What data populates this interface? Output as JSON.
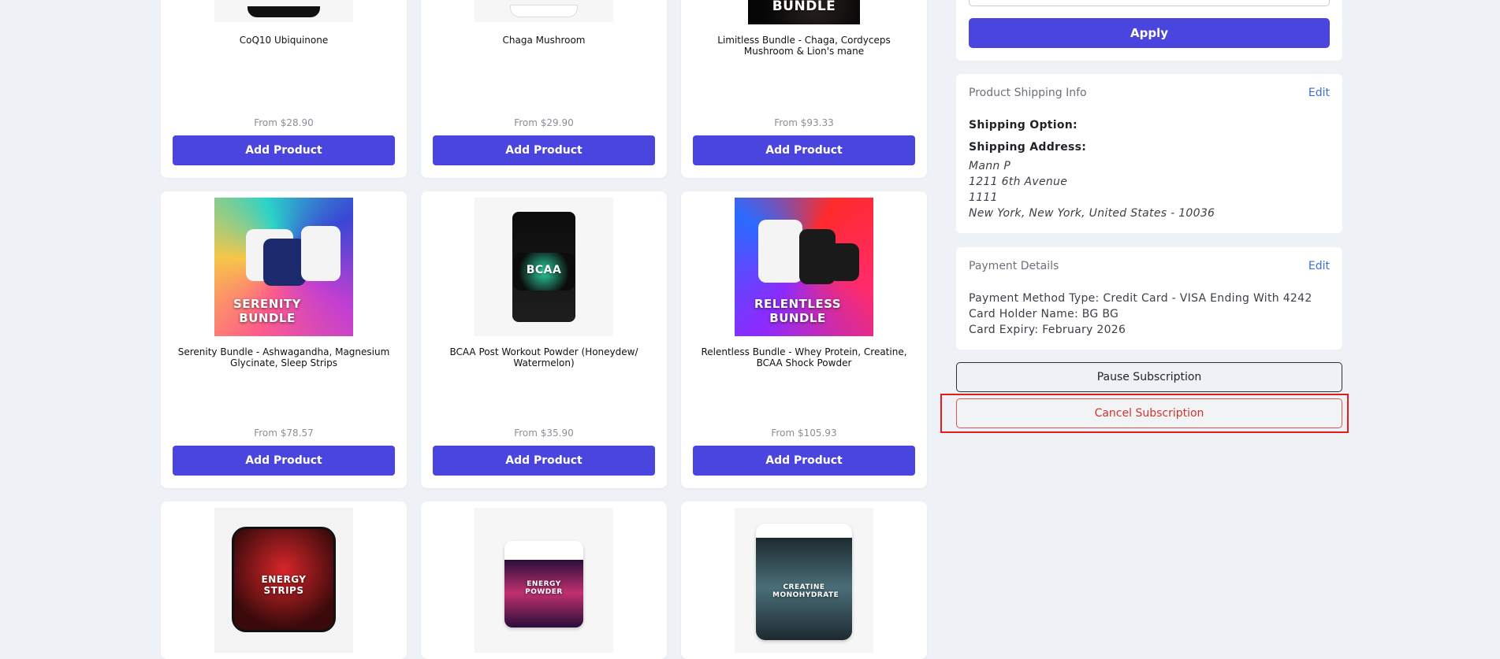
{
  "products": [
    {
      "name": "CoQ10 Ubiquinone",
      "price": "From $28.90",
      "button": "Add Product",
      "art_text": ""
    },
    {
      "name": "Chaga Mushroom",
      "price": "From $29.90",
      "button": "Add Product",
      "art_text": ""
    },
    {
      "name": "Limitless Bundle - Chaga, Cordyceps Mushroom & Lion's mane",
      "price": "From $93.33",
      "button": "Add Product",
      "art_text": "BUNDLE"
    },
    {
      "name": "Serenity Bundle - Ashwagandha, Magnesium Glycinate, Sleep Strips",
      "price": "From $78.57",
      "button": "Add Product",
      "art_text": "SERENITY BUNDLE"
    },
    {
      "name": "BCAA Post Workout Powder (Honeydew/ Watermelon)",
      "price": "From $35.90",
      "button": "Add Product",
      "art_text": "BCAA"
    },
    {
      "name": "Relentless Bundle - Whey Protein, Creatine, BCAA Shock Powder",
      "price": "From $105.93",
      "button": "Add Product",
      "art_text": "RELENTLESS BUNDLE"
    },
    {
      "name": "",
      "price": "",
      "button": "",
      "art_text": "ENERGY STRIPS"
    },
    {
      "name": "",
      "price": "",
      "button": "",
      "art_text": "ENERGY POWDER"
    },
    {
      "name": "",
      "price": "",
      "button": "",
      "art_text": "CREATINE MONOHYDRATE"
    }
  ],
  "coupon": {
    "apply_label": "Apply"
  },
  "shipping": {
    "title": "Product Shipping Info",
    "edit": "Edit",
    "option_label": "Shipping Option:",
    "address_label": "Shipping Address:",
    "address_lines": [
      "Mann P",
      "1211 6th Avenue",
      "1111",
      "New York, New York, United States - 10036"
    ]
  },
  "payment": {
    "title": "Payment Details",
    "edit": "Edit",
    "method": "Payment Method Type: Credit Card - VISA Ending With 4242",
    "holder": "Card Holder Name: BG BG",
    "expiry": "Card Expiry: February 2026"
  },
  "actions": {
    "pause": "Pause Subscription",
    "cancel": "Cancel Subscription"
  },
  "colors": {
    "primary": "#4b45df",
    "link": "#3b6fd6",
    "danger": "#d0342c",
    "highlight": "#e31b1b",
    "background": "#eef1f5"
  }
}
